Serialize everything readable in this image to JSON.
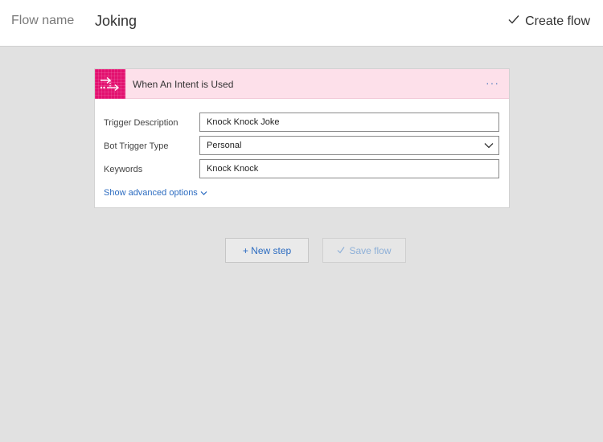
{
  "header": {
    "flow_name_label": "Flow name",
    "flow_name_value": "Joking",
    "create_flow_label": "Create flow"
  },
  "trigger_card": {
    "title": "When An Intent is Used",
    "more_label": "···",
    "icon": "flow-arrows-icon",
    "accent_color": "#e3106f",
    "header_color": "#fde0ea",
    "fields": {
      "trigger_description": {
        "label": "Trigger Description",
        "value": "Knock Knock Joke"
      },
      "bot_trigger_type": {
        "label": "Bot Trigger Type",
        "value": "Personal"
      },
      "keywords": {
        "label": "Keywords",
        "value": "Knock Knock"
      }
    },
    "advanced_label": "Show advanced options"
  },
  "actions": {
    "new_step_label": "+ New step",
    "save_flow_label": "Save flow"
  }
}
